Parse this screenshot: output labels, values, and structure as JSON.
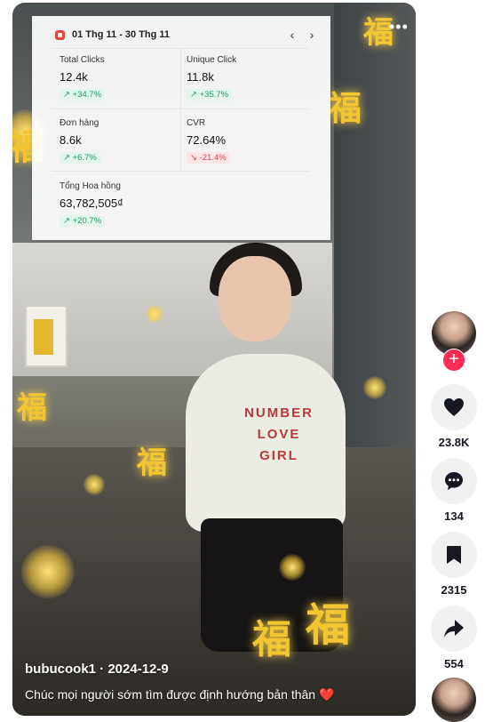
{
  "stats_panel": {
    "date_range": "01 Thg 11 - 30 Thg 11",
    "prev_icon": "chevron-left-icon",
    "next_icon": "chevron-right-icon",
    "metrics": [
      {
        "label": "Total Clicks",
        "value": "12.4k",
        "change": "+34.7%",
        "trend": "up"
      },
      {
        "label": "Unique Click",
        "value": "11.8k",
        "change": "+35.7%",
        "trend": "up"
      },
      {
        "label": "Đơn hàng",
        "value": "8.6k",
        "change": "+6.7%",
        "trend": "up"
      },
      {
        "label": "CVR",
        "value": "72.64%",
        "change": "-21.4%",
        "trend": "down"
      },
      {
        "label": "Tổng Hoa hồng",
        "value": "63,782,505₫",
        "change": "+20.7%",
        "trend": "up"
      }
    ]
  },
  "video": {
    "more_label": "•••",
    "shirt_text": "NUMBER\nLOVE\nGIRL",
    "fu_char": "福",
    "author": "bubucook1 · 2024-12-9",
    "caption": "Chúc mọi người sớm tìm được định hướng bản thân",
    "caption_emoji": "❤️"
  },
  "actions": {
    "likes": "23.8K",
    "comments": "134",
    "saves": "2315",
    "shares": "554",
    "follow_label": "+"
  },
  "colors": {
    "follow": "#fe2c55",
    "up": "#1ea36a",
    "down": "#d9484f"
  }
}
